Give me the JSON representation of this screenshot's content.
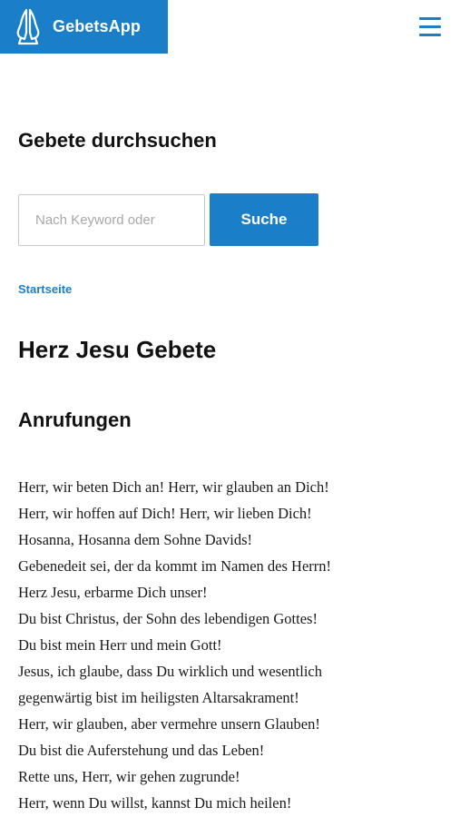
{
  "header": {
    "app_name": "GebetsApp",
    "logo_icon": "praying-hands-icon",
    "menu_icon": "hamburger-menu-icon",
    "brand_color": "#1a7fc8"
  },
  "search": {
    "heading": "Gebete durchsuchen",
    "placeholder": "Nach Keyword oder",
    "value": "",
    "button_label": "Suche"
  },
  "breadcrumb": {
    "items": [
      "Startseite"
    ]
  },
  "page": {
    "title": "Herz Jesu Gebete",
    "section_title": "Anrufungen",
    "lines": [
      "Herr, wir beten Dich an! Herr, wir glauben an Dich!",
      "Herr, wir hoffen auf Dich! Herr, wir lieben Dich!",
      "Hosanna, Hosanna dem Sohne Davids!",
      "Gebenedeit sei, der da kommt im Namen des Herrn!",
      "Herz Jesu, erbarme Dich unser!",
      "Du bist Christus, der Sohn des lebendigen Gottes!",
      "Du bist mein Herr und mein Gott!",
      "Jesus, ich glaube, dass Du wirklich und wesentlich",
      "gegenwärtig bist im heiligsten Altarsakrament!",
      "Herr, wir glauben, aber vermehre unsern Glauben!",
      "Du bist die Auferstehung und das Leben!",
      "Rette uns, Herr, wir gehen zugrunde!",
      "Herr, wenn Du willst, kannst Du mich heilen!"
    ]
  }
}
